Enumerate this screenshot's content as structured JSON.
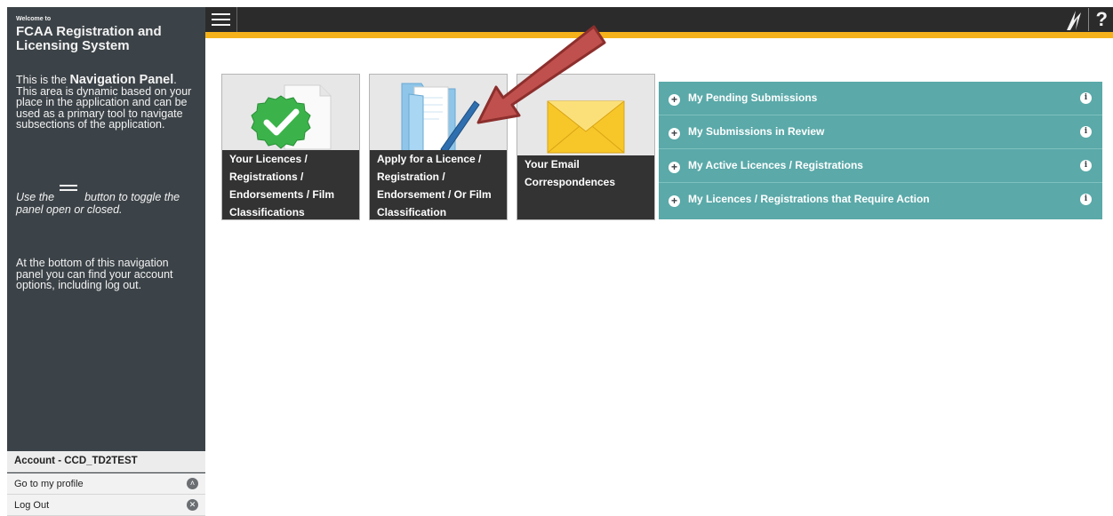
{
  "sidebar": {
    "welcome": "Welcome to",
    "title": "FCAA Registration and Licensing System",
    "intro_prefix": "This is the ",
    "intro_bold": "Navigation Panel",
    "intro_suffix": ". This area is dynamic based on your place in the application and can be used as a primary tool to navigate subsections of the application.",
    "toggle_before": "Use the",
    "toggle_after": "button to toggle the panel open or closed.",
    "bottom_note": "At the bottom of this navigation panel you can find your account options, including log out.",
    "account_label": "Account - CCD_TD2TEST",
    "links": [
      {
        "label": "Go to my profile",
        "icon": "chevron-up-circle-icon"
      },
      {
        "label": "Log Out",
        "icon": "close-circle-icon"
      }
    ]
  },
  "topbar": {
    "help_label": "?",
    "accent_color": "#f5b21b"
  },
  "tiles": [
    {
      "caption": "Your Licences / Registrations / Endorsements / Film Classifications",
      "icon": "green-checkmark-document-icon"
    },
    {
      "caption": "Apply for a Licence / Registration / Endorsement / Or Film Classification",
      "icon": "folder-pen-icon"
    },
    {
      "caption": "Your Email Correspondences",
      "icon": "envelope-icon"
    }
  ],
  "accordion": {
    "items": [
      {
        "label": "My Pending Submissions"
      },
      {
        "label": "My Submissions in Review"
      },
      {
        "label": "My Active Licences / Registrations"
      },
      {
        "label": "My Licences / Registrations that Require Action"
      }
    ],
    "color": "#5ba9a9"
  },
  "annotation": {
    "arrow_color": "#c0504d"
  }
}
